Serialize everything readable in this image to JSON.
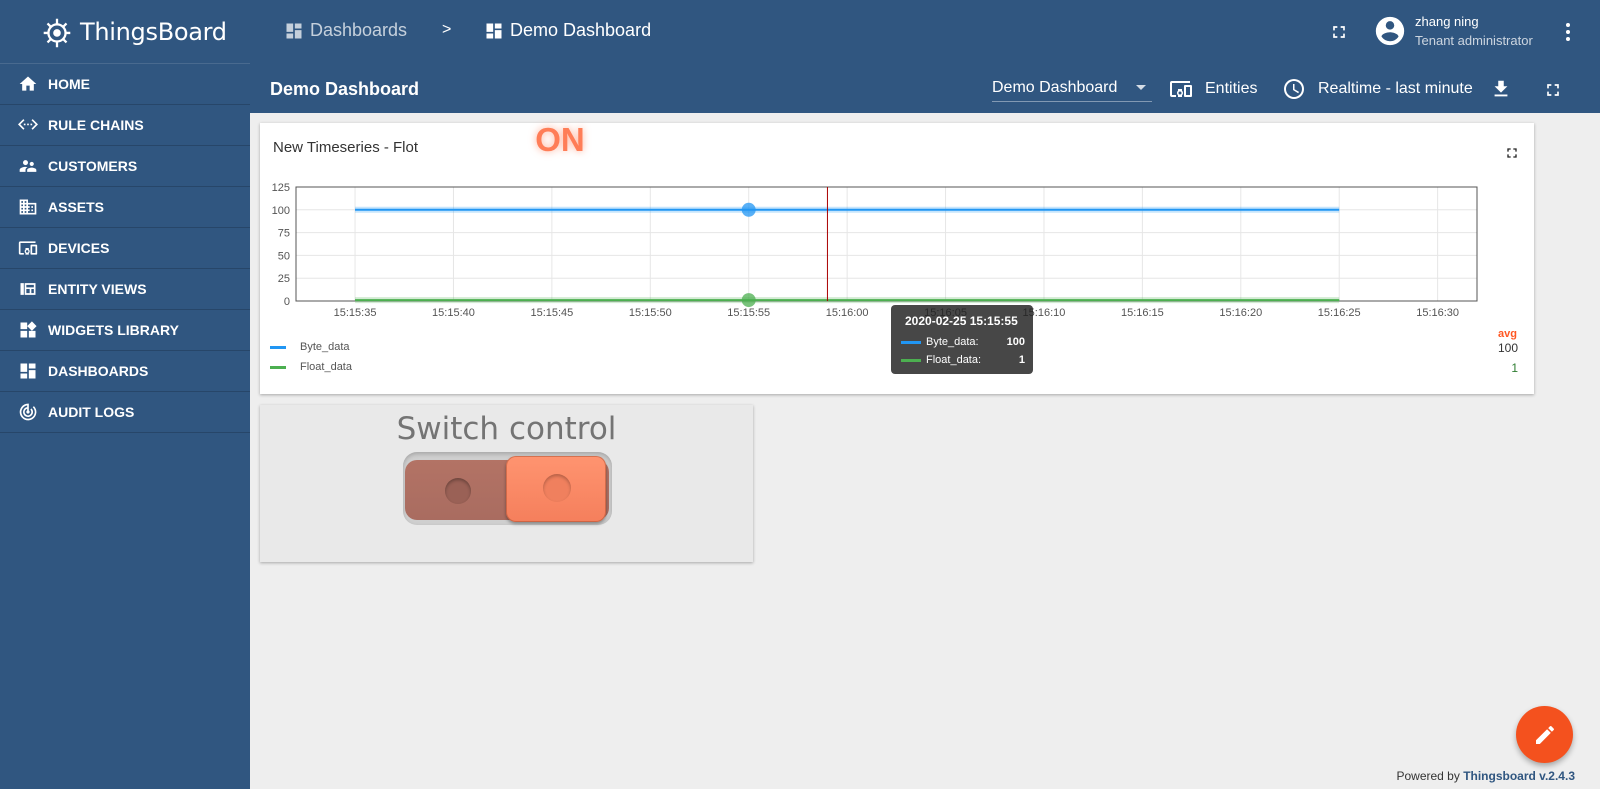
{
  "app": {
    "name": "ThingsBoard"
  },
  "sidebar": {
    "items": [
      {
        "label": "HOME",
        "icon": "home-icon"
      },
      {
        "label": "RULE CHAINS",
        "icon": "settings-ethernet-icon"
      },
      {
        "label": "CUSTOMERS",
        "icon": "supervisor-account-icon"
      },
      {
        "label": "ASSETS",
        "icon": "domain-icon"
      },
      {
        "label": "DEVICES",
        "icon": "devices-other-icon"
      },
      {
        "label": "ENTITY VIEWS",
        "icon": "view-quilt-icon"
      },
      {
        "label": "WIDGETS LIBRARY",
        "icon": "widgets-icon"
      },
      {
        "label": "DASHBOARDS",
        "icon": "dashboards-icon"
      },
      {
        "label": "AUDIT LOGS",
        "icon": "track-changes-icon"
      }
    ]
  },
  "header": {
    "breadcrumb": [
      {
        "label": "Dashboards",
        "icon": "dashboards-icon"
      },
      {
        "label": "Demo Dashboard",
        "icon": "dashboards-icon"
      }
    ],
    "breadcrumb_separator": ">",
    "user": {
      "name": "zhang ning",
      "role": "Tenant administrator"
    }
  },
  "toolbar": {
    "title": "Demo Dashboard",
    "state_selected": "Demo Dashboard",
    "entities_label": "Entities",
    "timewindow_label": "Realtime - last minute"
  },
  "timeseries_widget": {
    "title": "New Timeseries - Flot",
    "legend_header": "avg",
    "legend": [
      {
        "name": "Byte_data",
        "avg": "100",
        "color": "#2196f3"
      },
      {
        "name": "Float_data",
        "avg": "1",
        "color": "#4caf50"
      }
    ],
    "tooltip": {
      "title": "2020-02-25 15:15:55",
      "rows": [
        {
          "name": "Byte_data:",
          "value": "100",
          "color": "#2196f3"
        },
        {
          "name": "Float_data:",
          "value": "1",
          "color": "#4caf50"
        }
      ]
    }
  },
  "chart_data": {
    "type": "line",
    "title": "New Timeseries - Flot",
    "x_ticks": [
      "15:15:35",
      "15:15:40",
      "15:15:45",
      "15:15:50",
      "15:15:55",
      "15:16:00",
      "15:16:05",
      "15:16:10",
      "15:16:15",
      "15:16:20",
      "15:16:25",
      "15:16:30"
    ],
    "xlim": [
      "15:15:32",
      "15:16:32"
    ],
    "y_ticks": [
      0,
      25,
      50,
      75,
      100,
      125
    ],
    "ylim": [
      0,
      125
    ],
    "series": [
      {
        "name": "Byte_data",
        "color": "#2196f3",
        "x": [
          "15:15:35",
          "15:16:25"
        ],
        "values": [
          100,
          100
        ]
      },
      {
        "name": "Float_data",
        "color": "#4caf50",
        "x": [
          "15:15:35",
          "15:16:25"
        ],
        "values": [
          1,
          1
        ]
      }
    ],
    "hover_x": "15:15:55",
    "crosshair_x": "15:15:59",
    "grid": true
  },
  "switch_widget": {
    "title": "Switch control",
    "state": "ON",
    "on_color": "#ff7d57"
  },
  "footer": {
    "powered_prefix": "Powered by",
    "powered_brand": "Thingsboard v.2.4.3"
  }
}
